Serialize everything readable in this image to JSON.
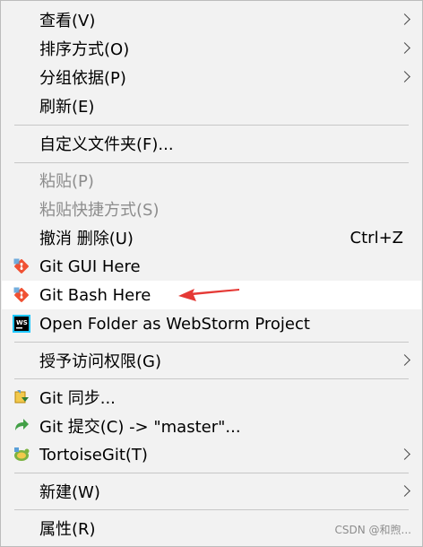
{
  "menu": {
    "items": [
      {
        "label": "查看(V)"
      },
      {
        "label": "排序方式(O)"
      },
      {
        "label": "分组依据(P)"
      },
      {
        "label": "刷新(E)"
      },
      {
        "label": "自定义文件夹(F)..."
      },
      {
        "label": "粘贴(P)"
      },
      {
        "label": "粘贴快捷方式(S)"
      },
      {
        "label": "撤消 删除(U)",
        "shortcut": "Ctrl+Z"
      },
      {
        "label": "Git GUI Here",
        "icon": "git-gui-icon"
      },
      {
        "label": "Git Bash Here",
        "icon": "git-bash-icon"
      },
      {
        "label": "Open Folder as WebStorm Project",
        "icon": "webstorm-icon"
      },
      {
        "label": "授予访问权限(G)"
      },
      {
        "label": "Git 同步...",
        "icon": "tortoisegit-sync-icon"
      },
      {
        "label": "Git 提交(C) -> \"master\"...",
        "icon": "tortoisegit-commit-icon"
      },
      {
        "label": "TortoiseGit(T)",
        "icon": "tortoisegit-icon"
      },
      {
        "label": "新建(W)"
      },
      {
        "label": "属性(R)"
      }
    ]
  },
  "colors": {
    "background": "#f2f2f2",
    "hover": "#ffffff",
    "disabled_text": "#8d8d8d",
    "annotation_arrow": "#e53935",
    "git_orange": "#f05133",
    "webstorm_dark": "#000000",
    "webstorm_accent": "#1ec6ff"
  },
  "watermark": "CSDN @和煦..."
}
